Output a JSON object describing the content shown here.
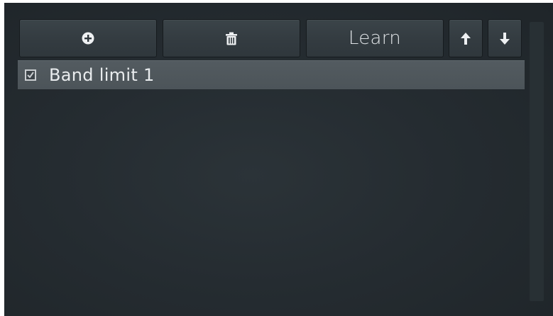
{
  "toolbar": {
    "add_icon": "plus-circle-icon",
    "delete_icon": "trash-icon",
    "learn_label": "Learn",
    "up_icon": "arrow-up-icon",
    "down_icon": "arrow-down-icon"
  },
  "list": {
    "items": [
      {
        "label": "Band limit 1",
        "checked": true
      }
    ]
  },
  "colors": {
    "panel_bg": "#252c31",
    "button_bg": "#343c41",
    "selected_row": "#50585d",
    "text": "#e9ecee"
  }
}
